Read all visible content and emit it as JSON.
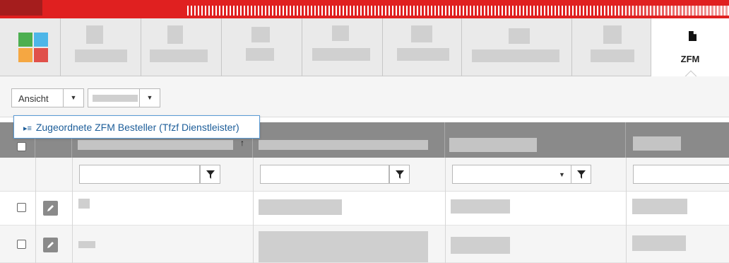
{
  "app": {
    "active_tab": {
      "label": "ZFM",
      "icon": "document-icon"
    },
    "logo_colors": [
      "#4caf50",
      "#4db6e8",
      "#f5a742",
      "#e0504a"
    ],
    "brand_color": "#e02020"
  },
  "toolbar": {
    "view_label": "Ansicht",
    "dropdown_arrow": "▼"
  },
  "popup": {
    "icon": "list-icon",
    "text": "Zugeordnete ZFM Besteller (Tfzf Dienstleister)"
  },
  "grid": {
    "sort_indicator": "↑",
    "filter_icon": "filter-icon",
    "edit_icon": "pencil-icon"
  }
}
